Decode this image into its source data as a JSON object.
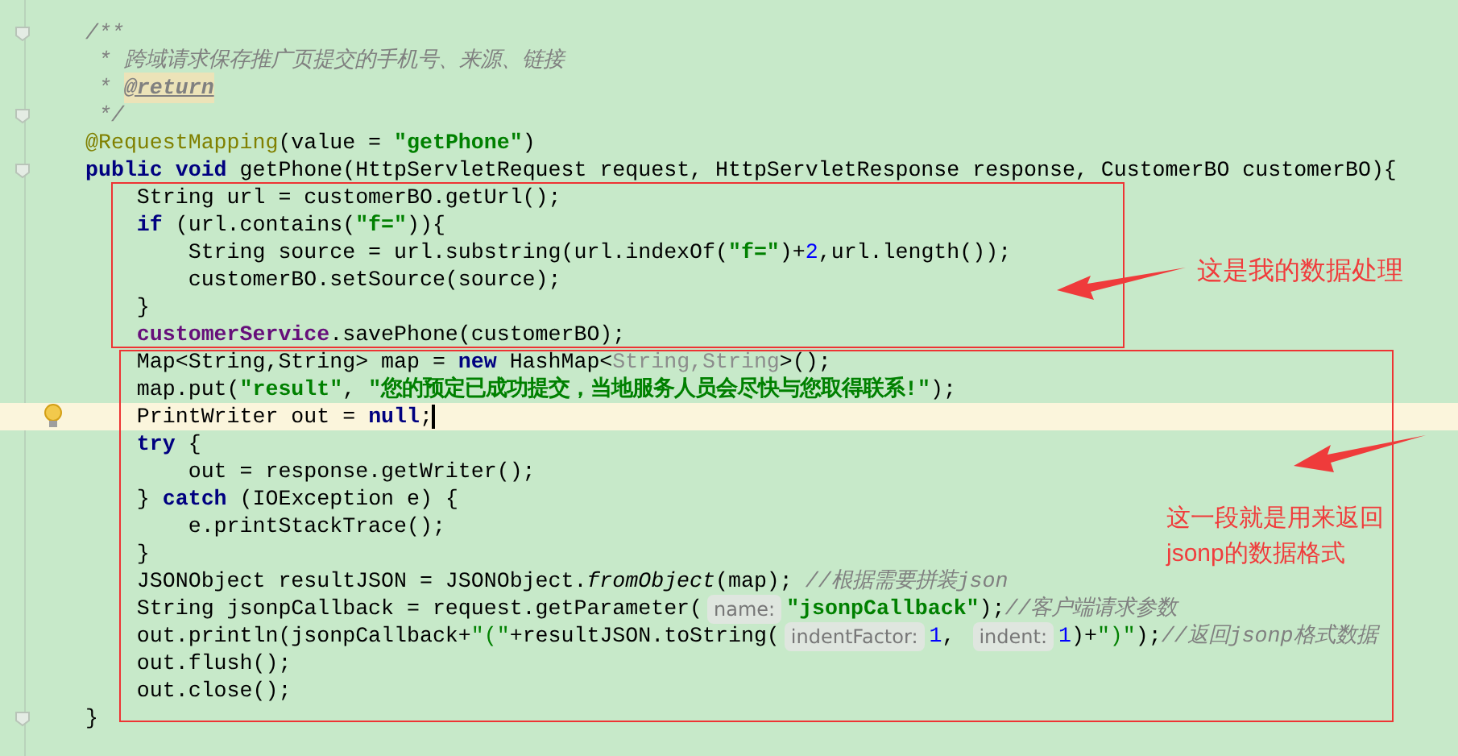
{
  "lines": [
    {
      "fold_marker": true,
      "bulb": false,
      "current": false,
      "tokens": [
        {
          "text": "/**",
          "kind": "comment"
        }
      ]
    },
    {
      "fold_marker": false,
      "bulb": false,
      "current": false,
      "tokens": [
        {
          "text": " * 跨域请求保存推广页提交的手机号、来源、链接",
          "kind": "comment"
        }
      ]
    },
    {
      "fold_marker": false,
      "bulb": false,
      "current": false,
      "tokens": [
        {
          "text": " * ",
          "kind": "comment"
        },
        {
          "text": "@return",
          "kind": "doc_tag"
        }
      ]
    },
    {
      "fold_marker": true,
      "bulb": false,
      "current": false,
      "tokens": [
        {
          "text": " */",
          "kind": "comment"
        }
      ]
    },
    {
      "fold_marker": false,
      "bulb": false,
      "current": false,
      "tokens": [
        {
          "text": "@RequestMapping",
          "kind": "annotation"
        },
        {
          "text": "(value = ",
          "kind": "plain"
        },
        {
          "text": "\"getPhone\"",
          "kind": "string"
        },
        {
          "text": ")",
          "kind": "plain"
        }
      ]
    },
    {
      "fold_marker": true,
      "bulb": false,
      "current": false,
      "tokens": [
        {
          "text": "public void ",
          "kind": "keyword"
        },
        {
          "text": "getPhone(HttpServletRequest request, HttpServletResponse response, CustomerBO customerBO){",
          "kind": "plain"
        }
      ]
    },
    {
      "fold_marker": false,
      "bulb": false,
      "current": false,
      "tokens": [
        {
          "text": "    String url = customerBO.getUrl();",
          "kind": "plain"
        }
      ]
    },
    {
      "fold_marker": false,
      "bulb": false,
      "current": false,
      "tokens": [
        {
          "text": "    if ",
          "kind": "keyword"
        },
        {
          "text": "(url.contains(",
          "kind": "plain"
        },
        {
          "text": "\"f=\"",
          "kind": "string"
        },
        {
          "text": ")){",
          "kind": "plain"
        }
      ]
    },
    {
      "fold_marker": false,
      "bulb": false,
      "current": false,
      "tokens": [
        {
          "text": "        String source = url.substring(url.indexOf(",
          "kind": "plain"
        },
        {
          "text": "\"f=\"",
          "kind": "string"
        },
        {
          "text": ")+",
          "kind": "plain"
        },
        {
          "text": "2",
          "kind": "number"
        },
        {
          "text": ",url.length());",
          "kind": "plain"
        }
      ]
    },
    {
      "fold_marker": false,
      "bulb": false,
      "current": false,
      "tokens": [
        {
          "text": "        customerBO.setSource(source);",
          "kind": "plain"
        }
      ]
    },
    {
      "fold_marker": false,
      "bulb": false,
      "current": false,
      "tokens": [
        {
          "text": "    }",
          "kind": "plain"
        }
      ]
    },
    {
      "fold_marker": false,
      "bulb": false,
      "current": false,
      "tokens": [
        {
          "text": "    customerService",
          "kind": "field"
        },
        {
          "text": ".savePhone(customerBO);",
          "kind": "plain"
        }
      ]
    },
    {
      "fold_marker": false,
      "bulb": false,
      "current": false,
      "tokens": [
        {
          "text": "    Map<String,String> map = ",
          "kind": "plain"
        },
        {
          "text": "new ",
          "kind": "keyword"
        },
        {
          "text": "HashMap<",
          "kind": "plain"
        },
        {
          "text": "String,String",
          "kind": "inferred"
        },
        {
          "text": ">();",
          "kind": "plain"
        }
      ]
    },
    {
      "fold_marker": false,
      "bulb": false,
      "current": false,
      "tokens": [
        {
          "text": "    map.put(",
          "kind": "plain"
        },
        {
          "text": "\"result\"",
          "kind": "string"
        },
        {
          "text": ", ",
          "kind": "plain"
        },
        {
          "text": "\"您的预定已成功提交，当地服务人员会尽快与您取得联系!\"",
          "kind": "string"
        },
        {
          "text": ");",
          "kind": "plain"
        }
      ]
    },
    {
      "fold_marker": false,
      "bulb": true,
      "current": true,
      "tokens": [
        {
          "text": "    PrintWriter out = ",
          "kind": "plain"
        },
        {
          "text": "null",
          "kind": "keyword"
        },
        {
          "text": ";",
          "kind": "plain"
        }
      ]
    },
    {
      "fold_marker": false,
      "bulb": false,
      "current": false,
      "tokens": [
        {
          "text": "    try ",
          "kind": "keyword"
        },
        {
          "text": "{",
          "kind": "plain"
        }
      ]
    },
    {
      "fold_marker": false,
      "bulb": false,
      "current": false,
      "tokens": [
        {
          "text": "        out = response.getWriter();",
          "kind": "plain"
        }
      ]
    },
    {
      "fold_marker": false,
      "bulb": false,
      "current": false,
      "tokens": [
        {
          "text": "    } ",
          "kind": "plain"
        },
        {
          "text": "catch ",
          "kind": "keyword"
        },
        {
          "text": "(IOException e) {",
          "kind": "plain"
        }
      ]
    },
    {
      "fold_marker": false,
      "bulb": false,
      "current": false,
      "tokens": [
        {
          "text": "        e.printStackTrace();",
          "kind": "plain"
        }
      ]
    },
    {
      "fold_marker": false,
      "bulb": false,
      "current": false,
      "tokens": [
        {
          "text": "    }",
          "kind": "plain"
        }
      ]
    },
    {
      "fold_marker": false,
      "bulb": false,
      "current": false,
      "tokens": [
        {
          "text": "    JSONObject resultJSON = JSONObject.",
          "kind": "plain"
        },
        {
          "text": "fromObject",
          "kind": "static"
        },
        {
          "text": "(map); ",
          "kind": "plain"
        },
        {
          "text": "//根据需要拼装",
          "kind": "comment"
        },
        {
          "text": "json",
          "kind": "comment_italic"
        }
      ]
    },
    {
      "fold_marker": false,
      "bulb": false,
      "current": false,
      "tokens": [
        {
          "text": "    String jsonpCallback = request.getParameter(",
          "kind": "plain"
        },
        {
          "text": "name:",
          "kind": "hint"
        },
        {
          "text": "\"jsonpCallback\"",
          "kind": "string"
        },
        {
          "text": ");",
          "kind": "plain"
        },
        {
          "text": "//客户端请求参数",
          "kind": "comment"
        }
      ]
    },
    {
      "fold_marker": false,
      "bulb": false,
      "current": false,
      "tokens": [
        {
          "text": "    out.println(jsonpCallback+",
          "kind": "plain"
        },
        {
          "text": "\"(\"",
          "kind": "string_plain"
        },
        {
          "text": "+resultJSON.toString(",
          "kind": "plain"
        },
        {
          "text": "indentFactor:",
          "kind": "hint"
        },
        {
          "text": "1",
          "kind": "number"
        },
        {
          "text": ", ",
          "kind": "plain"
        },
        {
          "text": "indent:",
          "kind": "hint"
        },
        {
          "text": "1",
          "kind": "number"
        },
        {
          "text": ")+",
          "kind": "plain"
        },
        {
          "text": "\")\"",
          "kind": "string_plain"
        },
        {
          "text": ");",
          "kind": "plain"
        },
        {
          "text": "//返回",
          "kind": "comment"
        },
        {
          "text": "jsonp",
          "kind": "comment_italic"
        },
        {
          "text": "格式数据",
          "kind": "comment"
        }
      ]
    },
    {
      "fold_marker": false,
      "bulb": false,
      "current": false,
      "tokens": [
        {
          "text": "    out.flush();",
          "kind": "plain"
        }
      ]
    },
    {
      "fold_marker": false,
      "bulb": false,
      "current": false,
      "tokens": [
        {
          "text": "    out.close();",
          "kind": "plain"
        }
      ]
    },
    {
      "fold_marker": true,
      "bulb": false,
      "current": false,
      "tokens": [
        {
          "text": "}",
          "kind": "plain"
        }
      ]
    }
  ],
  "notes": [
    {
      "text": "这是我的数据处理"
    },
    {
      "text": "这一段就是用来返回jsonp的数据格式"
    }
  ]
}
